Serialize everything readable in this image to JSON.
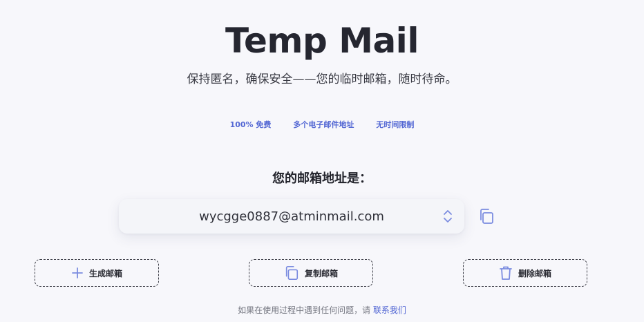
{
  "header": {
    "title": "Temp Mail",
    "subtitle": "保持匿名，确保安全——您的临时邮箱，随时待命。"
  },
  "features": [
    "100% 免费",
    "多个电子邮件地址",
    "无时间限制"
  ],
  "email": {
    "label": "您的邮箱地址是：",
    "address": "wycgge0887@atminmail.com"
  },
  "actions": {
    "generate_label": "生成邮箱",
    "copy_label": "复制邮箱",
    "delete_label": "删除邮箱"
  },
  "footer": {
    "text": "如果在使用过程中遇到任何问题，请 ",
    "link": "联系我们"
  },
  "colors": {
    "accent": "#5468d4",
    "icon": "#7b8ce0",
    "background": "#f7f7fb"
  }
}
